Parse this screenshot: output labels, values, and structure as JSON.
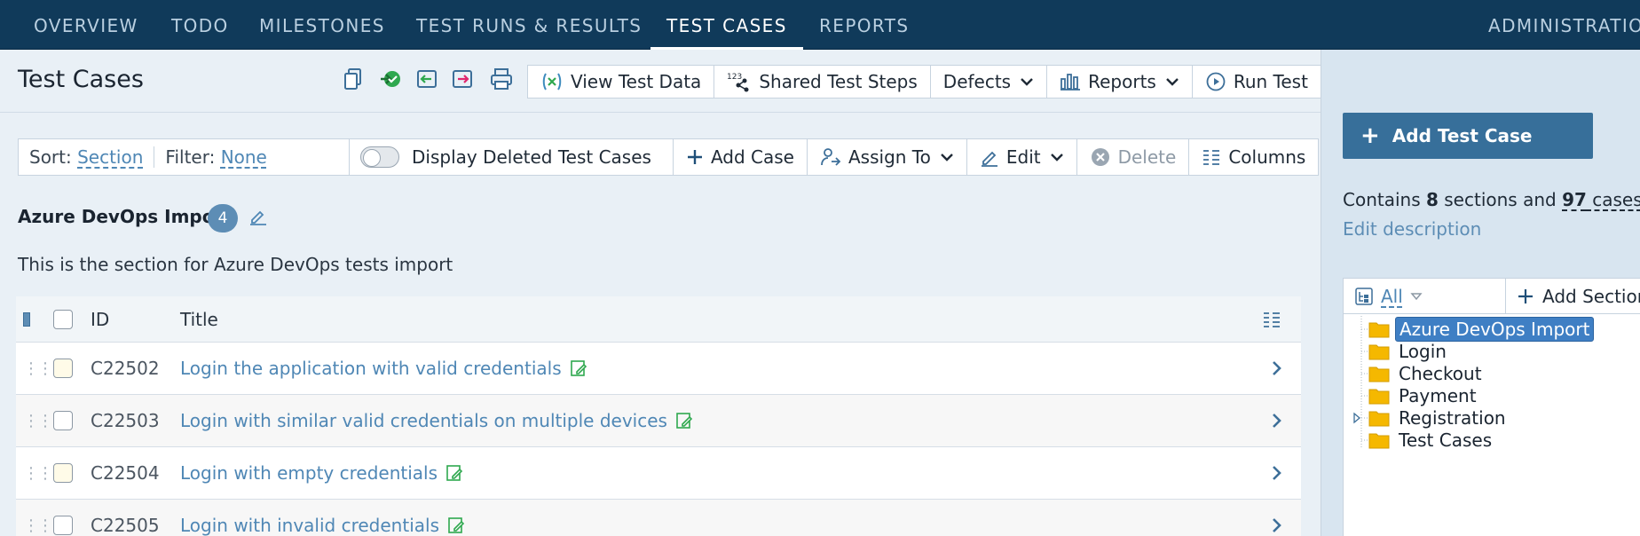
{
  "nav": {
    "tabs": [
      {
        "label": "OVERVIEW"
      },
      {
        "label": "TODO"
      },
      {
        "label": "MILESTONES"
      },
      {
        "label": "TEST RUNS & RESULTS"
      },
      {
        "label": "TEST CASES"
      },
      {
        "label": "REPORTS"
      }
    ],
    "admin": "ADMINISTRATION",
    "active_tab": "TEST CASES"
  },
  "header": {
    "title": "Test Cases",
    "toolbar": {
      "view_test_data": "View Test Data",
      "shared_test_steps": "Shared Test Steps",
      "defects": "Defects",
      "reports": "Reports",
      "run_test": "Run Test"
    }
  },
  "filters": {
    "sort_label": "Sort:",
    "sort_value": "Section",
    "filter_label": "Filter:",
    "filter_value": "None",
    "display_deleted": "Display Deleted Test Cases",
    "add_case": "Add Case",
    "assign_to": "Assign To",
    "edit": "Edit",
    "delete": "Delete",
    "columns": "Columns"
  },
  "section": {
    "name": "Azure DevOps Import",
    "count": "4",
    "description": "This is the section for Azure DevOps tests import"
  },
  "table": {
    "headers": {
      "id": "ID",
      "title": "Title"
    },
    "rows": [
      {
        "id": "C22502",
        "title": "Login the application with valid credentials"
      },
      {
        "id": "C22503",
        "title": "Login with similar valid credentials on multiple devices"
      },
      {
        "id": "C22504",
        "title": "Login with empty credentials"
      },
      {
        "id": "C22505",
        "title": "Login with invalid credentials"
      }
    ]
  },
  "sidebar": {
    "add_test_case": "Add Test Case",
    "contains_prefix": "Contains ",
    "sections_count": "8",
    "sections_word": " sections and ",
    "cases_count": "97",
    "cases_word": " cases",
    "contains_suffix": ".",
    "edit_description": "Edit description",
    "tree": {
      "filter": "All",
      "add_section": "Add Section",
      "items": [
        {
          "label": "Azure DevOps Import",
          "selected": true
        },
        {
          "label": "Login"
        },
        {
          "label": "Checkout"
        },
        {
          "label": "Payment"
        },
        {
          "label": "Registration",
          "expandable": true
        },
        {
          "label": "Test Cases"
        }
      ]
    }
  },
  "colors": {
    "nav_bg": "#103a5a",
    "accent": "#376f9a",
    "link": "#4f87b5",
    "folder": "#f5b800"
  }
}
